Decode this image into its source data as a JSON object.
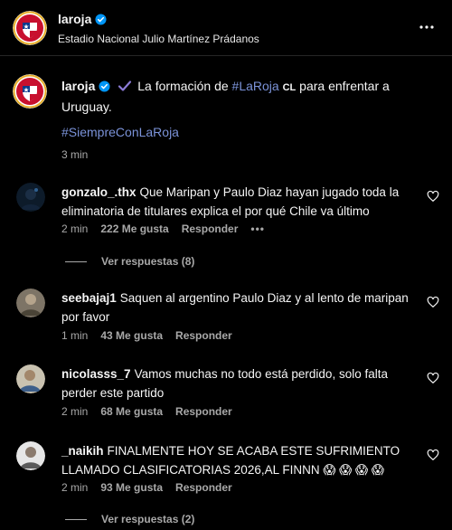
{
  "header": {
    "username": "laroja",
    "location": "Estadio Nacional Julio Martínez Prádanos",
    "more_icon": "more-horizontal-icon"
  },
  "caption": {
    "username": "laroja",
    "text_before": "La formación de ",
    "hashtag_inline": "#LaRoja",
    "flag": "CL",
    "text_after": " para enfrentar a Uruguay.",
    "hashtag": "#SiempreConLaRoja",
    "time": "3 min"
  },
  "comments": [
    {
      "username": "gonzalo_.thx",
      "text": "Que Maripan y Paulo Diaz hayan jugado toda la eliminatoria de titulares explica el por qué Chile va último",
      "time": "2 min",
      "likes": "222 Me gusta",
      "reply": "Responder",
      "more": "•••",
      "view_replies": "Ver respuestas (8)"
    },
    {
      "username": "seebajaj1",
      "text": "Saquen al argentino Paulo Diaz y al lento de maripan por favor",
      "time": "1 min",
      "likes": "43 Me gusta",
      "reply": "Responder"
    },
    {
      "username": "nicolasss_7",
      "text": "Vamos muchas no todo está perdido, solo falta perder este partido",
      "time": "2 min",
      "likes": "68 Me gusta",
      "reply": "Responder"
    },
    {
      "username": "_naikih",
      "text": "FINALMENTE HOY SE ACABA ESTE SUFRIMIENTO LLAMADO CLASIFICATORIAS 2026,AL FINNN 😱 😱 😱 😱",
      "time": "2 min",
      "likes": "93 Me gusta",
      "reply": "Responder",
      "view_replies": "Ver respuestas (2)"
    }
  ],
  "colors": {
    "background": "#000000",
    "text": "#f5f5f5",
    "secondary": "#a8a8a8",
    "hashtag": "#7b93d9",
    "verified": "#0095f6"
  }
}
